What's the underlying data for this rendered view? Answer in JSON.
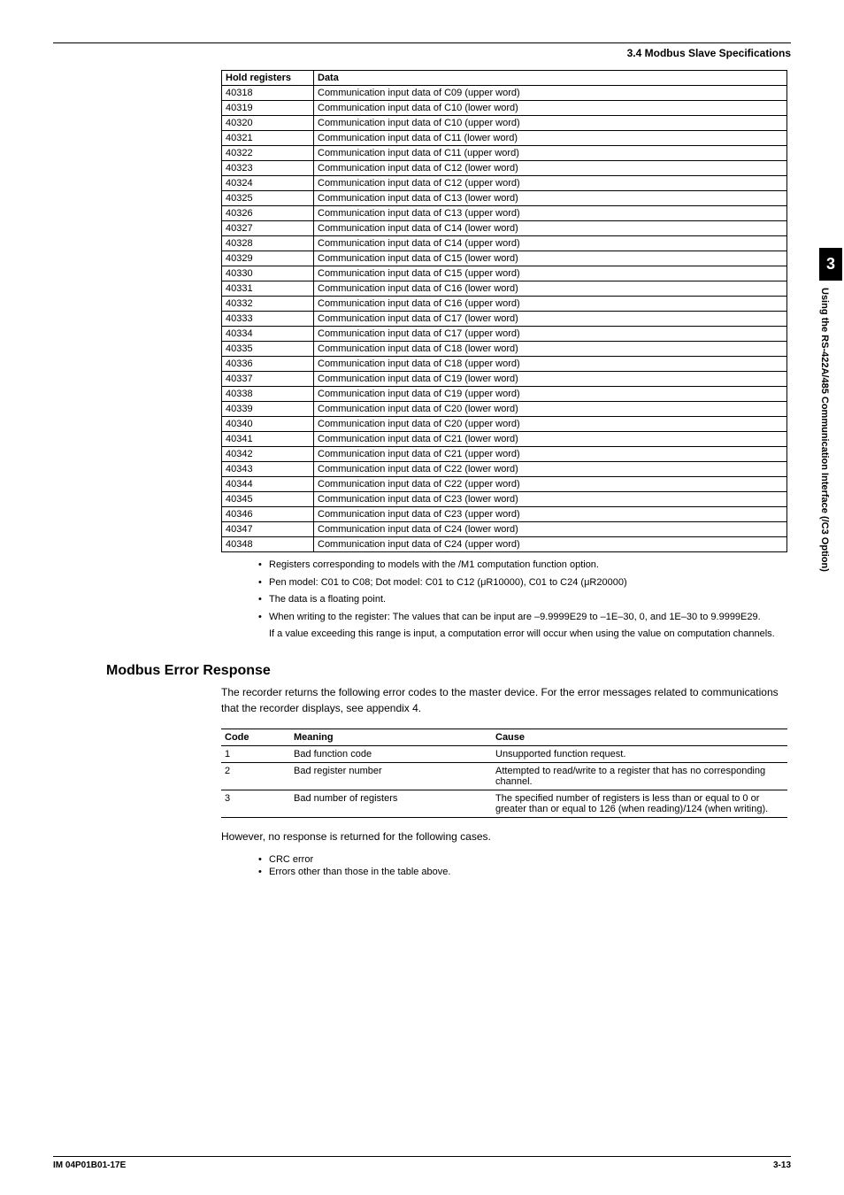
{
  "header": {
    "section": "3.4  Modbus Slave Specifications"
  },
  "hold_table": {
    "head": {
      "c1": "Hold registers",
      "c2": "Data"
    },
    "rows": [
      {
        "reg": "40318",
        "data": "Communication input data of C09 (upper word)"
      },
      {
        "reg": "40319",
        "data": "Communication input data of C10 (lower word)"
      },
      {
        "reg": "40320",
        "data": "Communication input data of C10 (upper word)"
      },
      {
        "reg": "40321",
        "data": "Communication input data of C11 (lower word)"
      },
      {
        "reg": "40322",
        "data": "Communication input data of C11 (upper word)"
      },
      {
        "reg": "40323",
        "data": "Communication input data of C12 (lower word)"
      },
      {
        "reg": "40324",
        "data": "Communication input data of C12 (upper word)"
      },
      {
        "reg": "40325",
        "data": "Communication input data of C13 (lower word)"
      },
      {
        "reg": "40326",
        "data": "Communication input data of C13 (upper word)"
      },
      {
        "reg": "40327",
        "data": "Communication input data of C14 (lower word)"
      },
      {
        "reg": "40328",
        "data": "Communication input data of C14 (upper word)"
      },
      {
        "reg": "40329",
        "data": "Communication input data of C15 (lower word)"
      },
      {
        "reg": "40330",
        "data": "Communication input data of C15 (upper word)"
      },
      {
        "reg": "40331",
        "data": "Communication input data of C16 (lower word)"
      },
      {
        "reg": "40332",
        "data": "Communication input data of C16 (upper word)"
      },
      {
        "reg": "40333",
        "data": "Communication input data of C17 (lower word)"
      },
      {
        "reg": "40334",
        "data": "Communication input data of C17 (upper word)"
      },
      {
        "reg": "40335",
        "data": "Communication input data of C18 (lower word)"
      },
      {
        "reg": "40336",
        "data": "Communication input data of C18 (upper word)"
      },
      {
        "reg": "40337",
        "data": "Communication input data of C19 (lower word)"
      },
      {
        "reg": "40338",
        "data": "Communication input data of C19 (upper word)"
      },
      {
        "reg": "40339",
        "data": "Communication input data of C20 (lower word)"
      },
      {
        "reg": "40340",
        "data": "Communication input data of C20 (upper word)"
      },
      {
        "reg": "40341",
        "data": "Communication input data of C21 (lower word)"
      },
      {
        "reg": "40342",
        "data": "Communication input data of C21 (upper word)"
      },
      {
        "reg": "40343",
        "data": "Communication input data of C22 (lower word)"
      },
      {
        "reg": "40344",
        "data": "Communication input data of C22 (upper word)"
      },
      {
        "reg": "40345",
        "data": "Communication input data of C23 (lower word)"
      },
      {
        "reg": "40346",
        "data": "Communication input data of C23 (upper word)"
      },
      {
        "reg": "40347",
        "data": "Communication input data of C24 (lower word)"
      },
      {
        "reg": "40348",
        "data": "Communication input data of C24 (upper word)"
      }
    ]
  },
  "notes": {
    "n1": "Registers corresponding to models with the /M1 computation function option.",
    "n2": "Pen model: C01 to C08; Dot model: C01 to C12 (μR10000), C01 to C24 (μR20000)",
    "n3": "The data is a floating point.",
    "n4": "When writing to the register: The values that can be input are –9.9999E29 to –1E–30, 0, and 1E–30 to 9.9999E29.",
    "n4b": "If a value exceeding this range is input, a computation error will occur when using the value on computation channels."
  },
  "error_section": {
    "title": "Modbus Error Response",
    "intro": "The recorder returns the following error codes to the master device. For the error messages related to communications that the recorder displays, see appendix 4."
  },
  "err_table": {
    "head": {
      "c1": "Code",
      "c2": "Meaning",
      "c3": "Cause"
    },
    "rows": [
      {
        "code": "1",
        "meaning": "Bad function code",
        "cause": "Unsupported function request."
      },
      {
        "code": "2",
        "meaning": "Bad register number",
        "cause": "Attempted to read/write to a register that has no corresponding channel."
      },
      {
        "code": "3",
        "meaning": "Bad number of registers",
        "cause": "The specified number of registers is less than or equal to 0 or greater than or equal to 126 (when reading)/124 (when writing)."
      }
    ]
  },
  "post": {
    "text": "However, no response is returned for the following cases.",
    "b1": "CRC error",
    "b2": "Errors other than those in the table above."
  },
  "sidebar": {
    "num": "3",
    "text": "Using the RS-422A/485 Communication Interface (/C3 Option)"
  },
  "footer": {
    "left": "IM 04P01B01-17E",
    "right": "3-13"
  }
}
